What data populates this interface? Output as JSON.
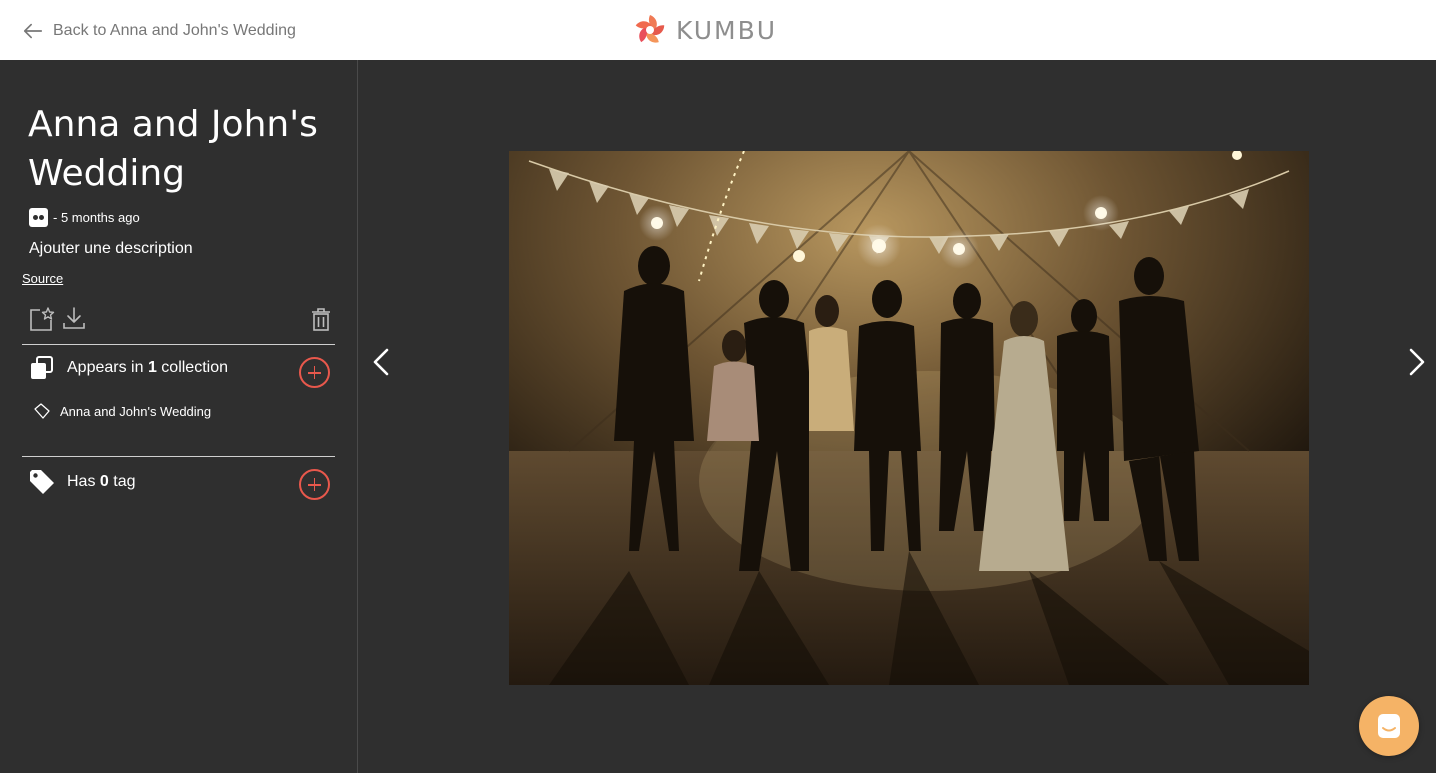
{
  "header": {
    "back_label": "Back to Anna and John's Wedding",
    "brand": "KUMBU"
  },
  "sidebar": {
    "title": "Anna and John's Wedding",
    "meta_time": "- 5 months ago",
    "description_placeholder": "Ajouter une description",
    "source_link": "Source",
    "collections": {
      "prefix": "Appears in ",
      "count": "1",
      "suffix": " collection",
      "items": [
        {
          "label": "Anna and John's Wedding"
        }
      ]
    },
    "tags": {
      "prefix": "Has ",
      "count": "0",
      "suffix": " tag"
    }
  },
  "colors": {
    "accent": "#e8584c",
    "background": "#2f2f2f",
    "chat_button": "#f5b366"
  },
  "icons": {
    "back": "arrow-left-icon",
    "favorite": "star-frame-icon",
    "download": "download-icon",
    "delete": "trash-icon",
    "collection": "collection-icon",
    "tag": "tag-icon",
    "prev": "chevron-left-icon",
    "next": "chevron-right-icon",
    "chat": "chat-icon"
  }
}
